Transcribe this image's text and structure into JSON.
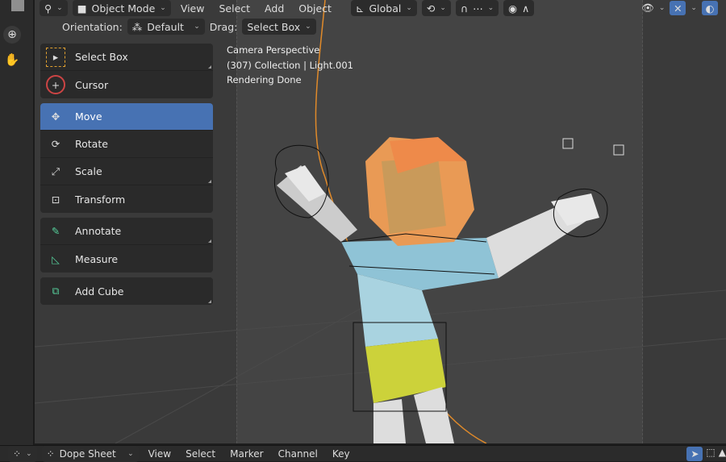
{
  "header": {
    "mode": "Object Mode",
    "menus": [
      "View",
      "Select",
      "Add",
      "Object"
    ],
    "transform_orientation": "Global"
  },
  "tool_settings": {
    "orientation_label": "Orientation:",
    "orientation_value": "Default",
    "drag_label": "Drag:",
    "drag_value": "Select Box"
  },
  "tools": [
    {
      "group": 1,
      "label": "Select Box",
      "icon": "select-box-icon"
    },
    {
      "group": 1,
      "label": "Cursor",
      "icon": "cursor-icon"
    },
    {
      "group": 2,
      "label": "Move",
      "icon": "move-icon",
      "active": true
    },
    {
      "group": 2,
      "label": "Rotate",
      "icon": "rotate-icon"
    },
    {
      "group": 2,
      "label": "Scale",
      "icon": "scale-icon"
    },
    {
      "group": 2,
      "label": "Transform",
      "icon": "transform-icon"
    },
    {
      "group": 3,
      "label": "Annotate",
      "icon": "annotate-icon"
    },
    {
      "group": 3,
      "label": "Measure",
      "icon": "measure-icon"
    },
    {
      "group": 4,
      "label": "Add Cube",
      "icon": "add-cube-icon"
    }
  ],
  "viewport_info": {
    "line1": "Camera Perspective",
    "line2": "(307) Collection | Light.001",
    "line3": "Rendering Done"
  },
  "bottom": {
    "editor": "Dope Sheet",
    "menus": [
      "View",
      "Select",
      "Marker",
      "Channel",
      "Key"
    ]
  },
  "colors": {
    "accent": "#4772b3",
    "camera_path": "#e08a2a"
  }
}
